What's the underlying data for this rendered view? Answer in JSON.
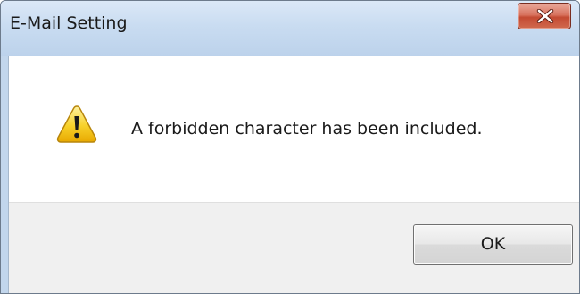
{
  "window": {
    "title": "E-Mail Setting",
    "close_icon": "close-icon"
  },
  "message": {
    "icon": "warning-icon",
    "text": "A forbidden character has been included."
  },
  "buttons": {
    "ok_label": "OK"
  },
  "colors": {
    "titlebar": "#c9dcf1",
    "close_button": "#c44a32",
    "button_area": "#f0f0f0",
    "warning_yellow": "#f5c400"
  }
}
